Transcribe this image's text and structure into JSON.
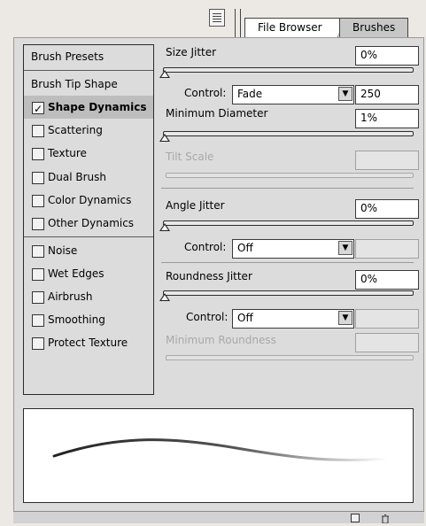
{
  "tabs": {
    "file_browser": "File Browser",
    "brushes": "Brushes"
  },
  "left_list": {
    "brush_presets": "Brush Presets",
    "brush_tip_shape": "Brush Tip Shape",
    "items": [
      {
        "label": "Shape Dynamics",
        "checked": true,
        "selected": true
      },
      {
        "label": "Scattering",
        "checked": false
      },
      {
        "label": "Texture",
        "checked": false
      },
      {
        "label": "Dual Brush",
        "checked": false
      },
      {
        "label": "Color Dynamics",
        "checked": false
      },
      {
        "label": "Other Dynamics",
        "checked": false
      },
      {
        "label": "Noise",
        "checked": false
      },
      {
        "label": "Wet Edges",
        "checked": false
      },
      {
        "label": "Airbrush",
        "checked": false
      },
      {
        "label": "Smoothing",
        "checked": false
      },
      {
        "label": "Protect Texture",
        "checked": false
      }
    ]
  },
  "size_jitter": {
    "label": "Size Jitter",
    "value": "0%",
    "level": 0
  },
  "size_control": {
    "label": "Control:",
    "value": "Fade",
    "steps": "250"
  },
  "minimum_diameter": {
    "label": "Minimum Diameter",
    "value": "1%",
    "level": 0.01
  },
  "tilt_scale": {
    "label": "Tilt Scale",
    "value": ""
  },
  "angle_jitter": {
    "label": "Angle Jitter",
    "value": "0%",
    "level": 0
  },
  "angle_control": {
    "label": "Control:",
    "value": "Off"
  },
  "roundness_jitter": {
    "label": "Roundness Jitter",
    "value": "0%",
    "level": 0
  },
  "roundness_control": {
    "label": "Control:",
    "value": "Off"
  },
  "minimum_roundness": {
    "label": "Minimum Roundness",
    "value": ""
  },
  "icons": {
    "panel_menu": "panel-menu-icon",
    "new_brush": "new-brush-icon",
    "trash": "trash-icon",
    "dropdown": "dropdown-arrow-icon"
  }
}
